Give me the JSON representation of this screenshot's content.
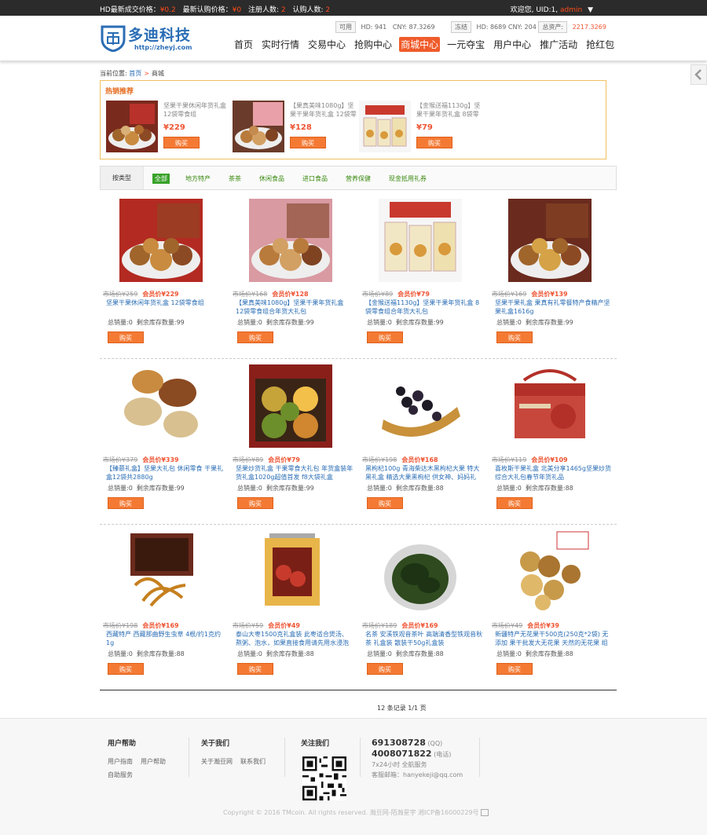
{
  "topbar": {
    "hd_last_label": "HD最新成交价格：",
    "hd_last_value": "¥0.2",
    "sub_last_label": "最新认购价格：",
    "sub_last_value": "¥0",
    "reg_label": "注册人数:",
    "reg_value": "2",
    "buy_label": "认购人数:",
    "buy_value": "2",
    "welcome": "欢迎您,",
    "uid": "UID:1,",
    "user": "admin"
  },
  "logo": {
    "name": "多迪科技",
    "url": "http://zheyj.com"
  },
  "quote": {
    "avail_tag": "可用",
    "avail_hd": "HD: 941",
    "avail_cny": "CNY: 87.3269",
    "frozen_tag": "冻结",
    "frozen_hd": "HD: 8689",
    "frozen_cny": "CNY: 204",
    "total_tag": "总资产:",
    "total_value": "2217.3269"
  },
  "nav": [
    "首页",
    "实时行情",
    "交易中心",
    "抢购中心",
    "商城中心",
    "一元夺宝",
    "用户中心",
    "推广活动",
    "抢红包"
  ],
  "breadcrumb": {
    "label": "当前位置:",
    "home": "首页",
    "current": "商城"
  },
  "hot": {
    "title": "热销推荐",
    "items": [
      {
        "name": "坚果干果休闲年货礼盒 12袋零食组",
        "price": "¥229",
        "buy": "购买"
      },
      {
        "name": "【果真美味1080g】坚果干果年货礼盒 12袋零",
        "price": "¥128",
        "buy": "购买"
      },
      {
        "name": "【金猴送福1130g】坚果干果年货礼盒 8袋零",
        "price": "¥79",
        "buy": "购买"
      }
    ]
  },
  "filter": {
    "label": "按类型",
    "options": [
      "全部",
      "地方特产",
      "茶茶",
      "休闲食品",
      "进口食品",
      "营养保健",
      "现金抵用礼券"
    ]
  },
  "product_labels": {
    "market": "市场价",
    "member": "会员价",
    "sold": "总销量:",
    "stock": "剩余库存数量:",
    "buy": "购买"
  },
  "products": [
    {
      "market": "¥259",
      "member": "¥229",
      "name": "坚果干果休闲年货礼盒 12袋零食组",
      "sold": "0",
      "stock": "99"
    },
    {
      "market": "¥168",
      "member": "¥128",
      "name": "【果真美味1080g】坚果干果年货礼盒 12袋零食组合年货大礼包",
      "sold": "0",
      "stock": "99"
    },
    {
      "market": "¥89",
      "member": "¥79",
      "name": "【金猴送福1130g】坚果干果年货礼盒 8袋零食组合年货大礼包",
      "sold": "0",
      "stock": "99"
    },
    {
      "market": "¥169",
      "member": "¥139",
      "name": "坚果干果礼盒 果真有礼零餐特产食精产坚果礼盒1616g",
      "sold": "0",
      "stock": "99"
    },
    {
      "market": "¥379",
      "member": "¥339",
      "name": "【臻慕礼盒】坚果大礼包 休闲零食 干果礼盒12袋共2880g",
      "sold": "0",
      "stock": "99"
    },
    {
      "market": "¥89",
      "member": "¥79",
      "name": "坚果炒货礼盒 干果零食大礼包 年货盒装年货礼盒1020g超值首发 f8大袋礼盒",
      "sold": "0",
      "stock": "99"
    },
    {
      "market": "¥198",
      "member": "¥168",
      "name": "黑枸杞100g 青海柴达木黑枸杞大果 特大黑礼盒 精选大果黑枸杞 供女神、妈妈礼",
      "sold": "0",
      "stock": "88"
    },
    {
      "market": "¥119",
      "member": "¥109",
      "name": "喜枚斯干果礼盒 北美分享1465g坚果炒货综合大礼包春节年货礼品",
      "sold": "0",
      "stock": "88"
    },
    {
      "market": "¥198",
      "member": "¥169",
      "name": "西藏特产 西藏那曲野生虫草 4根/约1克约1g",
      "sold": "0",
      "stock": "88"
    },
    {
      "market": "¥59",
      "member": "¥49",
      "name": "泰山大枣1500克礼盒装 此枣适合煲汤、熬粥、泡水，如果直接食用请先用水浸泡",
      "sold": "0",
      "stock": "88"
    },
    {
      "market": "¥189",
      "member": "¥169",
      "name": "名茶 安溪铁观音茶叶 高端清香型铁观音秋茶 礼盒装 散装干50g礼盒装",
      "sold": "0",
      "stock": "88"
    },
    {
      "market": "¥49",
      "member": "¥39",
      "name": "新疆特产无花果干500克(250克*2袋) 无添加 果干批发大无花果 天然的无花果 组",
      "sold": "0",
      "stock": "88"
    }
  ],
  "pager": "12 条记录 1/1 页",
  "footer": {
    "help_title": "用户帮助",
    "help_links": [
      "用户指南",
      "用户帮助",
      "自助服务"
    ],
    "about_title": "关于我们",
    "about_links": [
      "关于瀚豆网",
      "联系我们"
    ],
    "follow_title": "关注我们",
    "qq": "691308728",
    "qq_label": "(QQ)",
    "phone": "4008071822",
    "phone_label": "(电话)",
    "hours": "7x24小时 全航服务",
    "email": "客服邮箱：hanyekeji@qq.com",
    "copyright": "Copyright © 2016 TMcoin. All rights reserved. 瀚豆网-陌瀚星宇 湘ICP备16000229号"
  }
}
